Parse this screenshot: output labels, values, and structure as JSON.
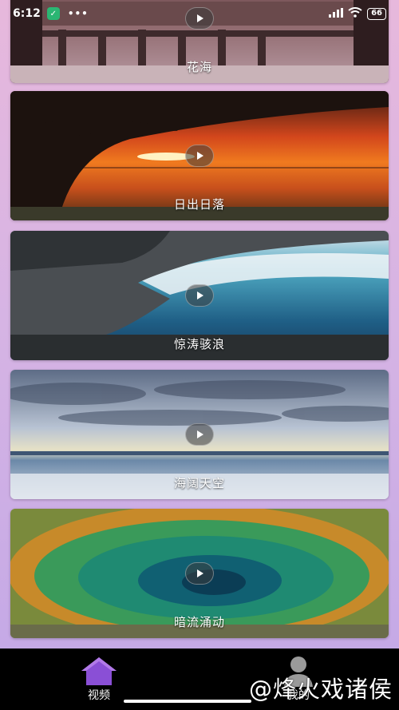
{
  "status_bar": {
    "time": "6:12",
    "battery": "66"
  },
  "videos": [
    {
      "title": "花海"
    },
    {
      "title": "日出日落"
    },
    {
      "title": "惊涛骇浪"
    },
    {
      "title": "海阔天空"
    },
    {
      "title": "暗流涌动"
    }
  ],
  "tabs": [
    {
      "label": "视频",
      "icon": "home-icon",
      "active": true
    },
    {
      "label": "我的",
      "icon": "person-icon",
      "active": false
    }
  ],
  "watermark": "@烽火戏诸侯",
  "colors": {
    "tab_active": "#8a4fd6",
    "tab_inactive": "#9a9a9a",
    "tab_bar_bg": "#000000"
  }
}
